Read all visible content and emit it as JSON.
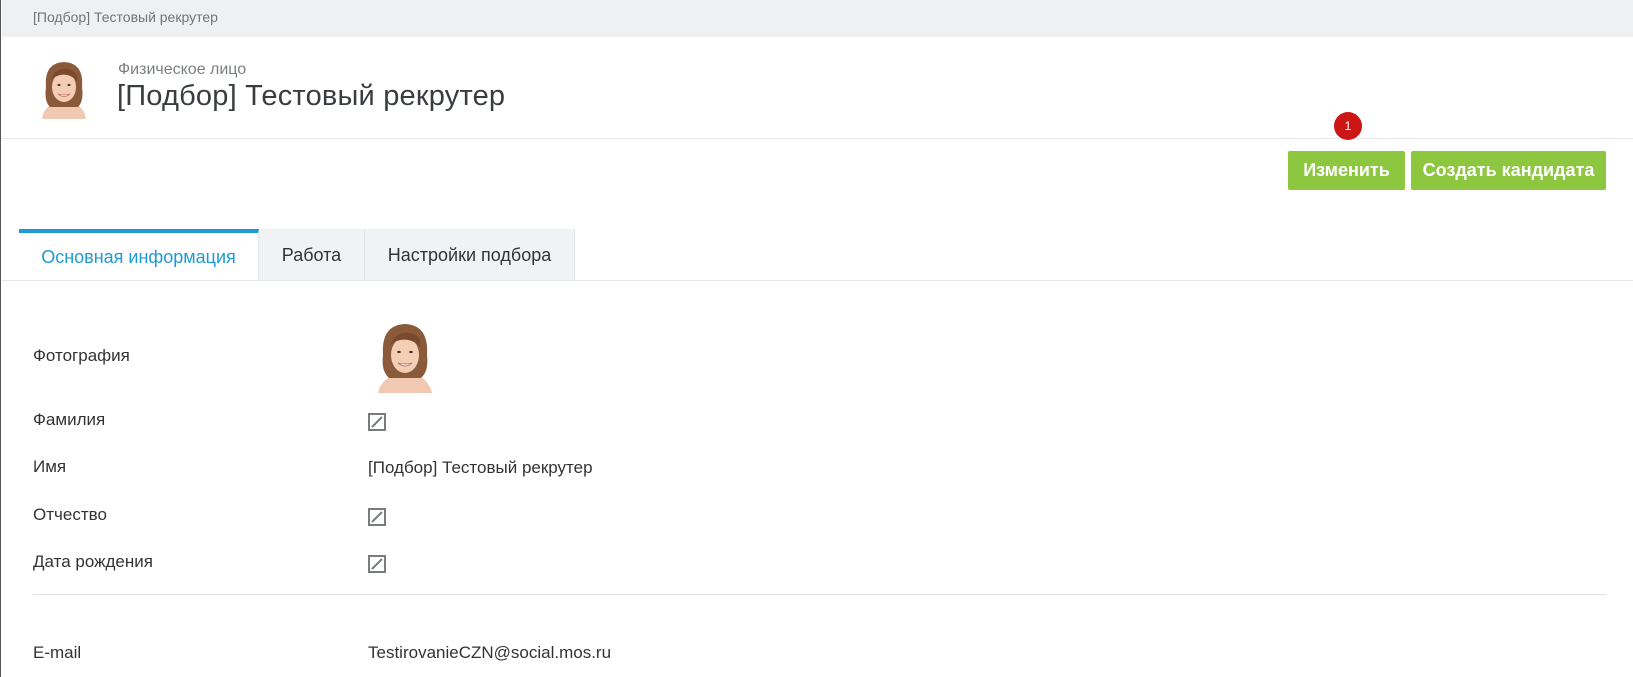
{
  "breadcrumb": {
    "text": "[Подбор] Тестовый рекрутер"
  },
  "header": {
    "entity_type": "Физическое лицо",
    "title": "[Подбор] Тестовый рекрутер"
  },
  "notification": {
    "count": "1",
    "color": "#cc1515"
  },
  "actions": {
    "edit_label": "Изменить",
    "create_candidate_label": "Создать кандидата",
    "accent_color": "#8dc63f"
  },
  "tabs": [
    {
      "label": "Основная информация",
      "active": true
    },
    {
      "label": "Работа",
      "active": false
    },
    {
      "label": "Настройки подбора",
      "active": false
    }
  ],
  "fields": {
    "photo": {
      "label": "Фотография"
    },
    "last_name": {
      "label": "Фамилия",
      "value": null,
      "icon": "empty-value-icon"
    },
    "first_name": {
      "label": "Имя",
      "value": "[Подбор] Тестовый рекрутер"
    },
    "patronymic": {
      "label": "Отчество",
      "value": null,
      "icon": "empty-value-icon"
    },
    "birth_date": {
      "label": "Дата рождения",
      "value": null,
      "icon": "empty-value-icon"
    },
    "email": {
      "label": "E-mail",
      "value": "TestirovanieCZN@social.mos.ru"
    }
  },
  "theme": {
    "tab_active_color": "#1d9ad6"
  }
}
